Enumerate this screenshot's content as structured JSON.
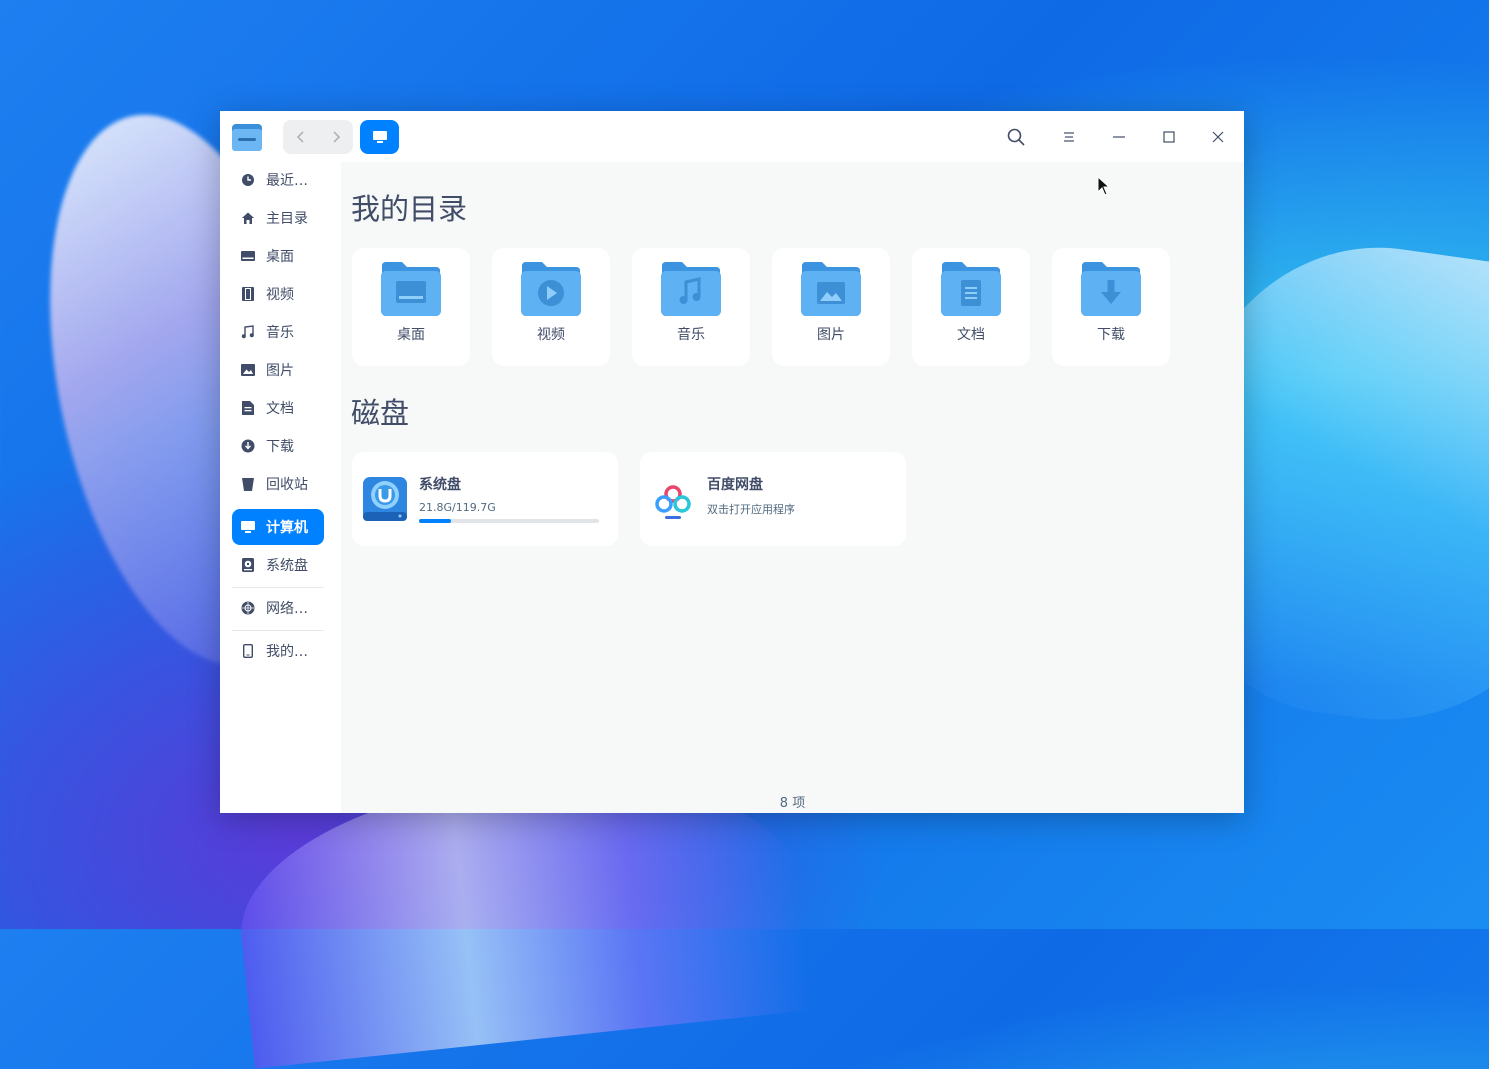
{
  "titlebar": {
    "back_icon": "chevron-left-icon",
    "forward_icon": "chevron-right-icon",
    "crumb_icon": "computer-icon"
  },
  "sidebar": {
    "items": [
      {
        "label": "最近…",
        "icon": "clock-icon"
      },
      {
        "label": "主目录",
        "icon": "home-icon"
      },
      {
        "label": "桌面",
        "icon": "desktop-icon"
      },
      {
        "label": "视频",
        "icon": "film-icon"
      },
      {
        "label": "音乐",
        "icon": "music-icon"
      },
      {
        "label": "图片",
        "icon": "picture-icon"
      },
      {
        "label": "文档",
        "icon": "document-icon"
      },
      {
        "label": "下载",
        "icon": "download-icon"
      },
      {
        "label": "回收站",
        "icon": "trash-icon"
      },
      {
        "label": "计算机",
        "icon": "computer-icon",
        "active": true
      },
      {
        "label": "系统盘",
        "icon": "disk-icon"
      },
      {
        "label": "网络…",
        "icon": "network-icon"
      },
      {
        "label": "我的…",
        "icon": "phone-icon"
      }
    ]
  },
  "main": {
    "my_dirs_title": "我的目录",
    "folders": [
      {
        "label": "桌面",
        "icon": "desktop-folder-icon"
      },
      {
        "label": "视频",
        "icon": "video-folder-icon"
      },
      {
        "label": "音乐",
        "icon": "music-folder-icon"
      },
      {
        "label": "图片",
        "icon": "pictures-folder-icon"
      },
      {
        "label": "文档",
        "icon": "documents-folder-icon"
      },
      {
        "label": "下载",
        "icon": "downloads-folder-icon"
      }
    ],
    "disks_title": "磁盘",
    "disks": [
      {
        "name": "系统盘",
        "detail": "21.8G/119.7G",
        "usage": 0.18,
        "icon": "system-disk-icon"
      },
      {
        "name": "百度网盘",
        "detail": "双击打开应用程序",
        "icon": "baidu-netdisk-icon"
      }
    ]
  },
  "status": {
    "item_count": "8 项"
  },
  "colors": {
    "accent": "#0081ff",
    "text": "#414d68",
    "folder": "#5eb1f3"
  }
}
